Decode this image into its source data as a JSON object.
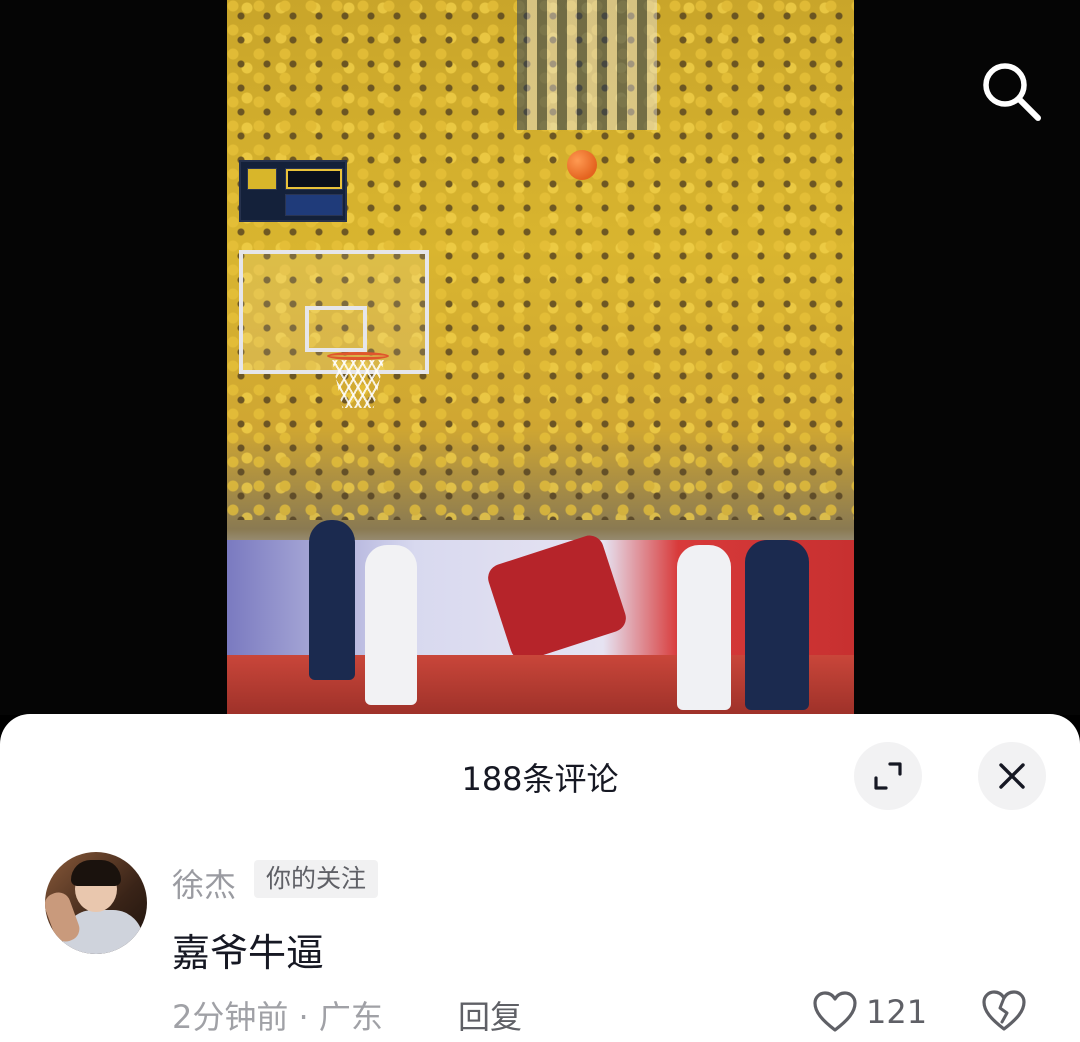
{
  "video": {
    "search_icon": "search-icon"
  },
  "comments_panel": {
    "title": "188条评论",
    "expand_icon": "expand-icon",
    "close_icon": "close-icon"
  },
  "comment": {
    "username": "徐杰",
    "tag": "你的关注",
    "text": "嘉爷牛逼",
    "time_location": "2分钟前 · 广东",
    "reply_label": "回复",
    "like_count": "121",
    "like_icon": "heart-outline-icon",
    "dislike_icon": "broken-heart-icon"
  },
  "colors": {
    "sheet_bg": "#ffffff",
    "primary_text": "#161823",
    "secondary_text": "#9a9ba1",
    "button_bg": "#f2f2f3"
  }
}
